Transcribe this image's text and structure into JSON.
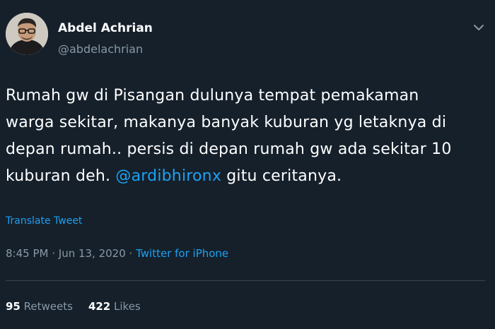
{
  "author": {
    "display_name": "Abdel Achrian",
    "handle": "@abdelachrian",
    "avatar_icon": "profile-photo"
  },
  "menu": {
    "icon": "chevron-down-icon"
  },
  "tweet": {
    "line1": "Rumah gw di Pisangan dulunya tempat pemakaman",
    "line2": "warga sekitar, makanya banyak kuburan yg letaknya di",
    "line3": "depan rumah.. persis di depan rumah gw ada sekitar 10",
    "line4_before": "kuburan deh. ",
    "mention": "@ardibhironx",
    "line4_after": " gitu ceritanya."
  },
  "translate_label": "Translate Tweet",
  "meta": {
    "time": "8:45 PM",
    "separator1": " · ",
    "date": "Jun 13, 2020",
    "separator2": " · ",
    "source": "Twitter for iPhone"
  },
  "stats": {
    "retweets_count": "95",
    "retweets_label": "Retweets",
    "likes_count": "422",
    "likes_label": "Likes"
  },
  "colors": {
    "background": "#15202b",
    "accent": "#1da1f2",
    "secondary_text": "#8899a6",
    "divider": "#38444d"
  }
}
